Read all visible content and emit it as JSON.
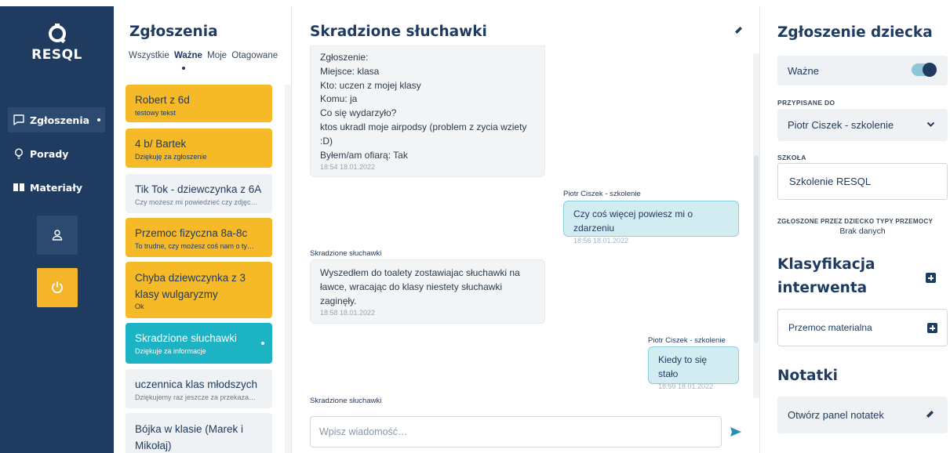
{
  "app": {
    "logo_text": "RESQL"
  },
  "nav": {
    "items": [
      {
        "label": "Zgłoszenia",
        "icon": "message-square-icon",
        "active": true
      },
      {
        "label": "Porady",
        "icon": "lightbulb-icon",
        "active": false
      },
      {
        "label": "Materiały",
        "icon": "book-icon",
        "active": false
      }
    ],
    "user_button": "user-icon",
    "power_button": "power-icon"
  },
  "reports": {
    "title": "Zgłoszenia",
    "filters": [
      "Wszystkie",
      "Ważne",
      "Moje",
      "Otagowane"
    ],
    "active_filter": "Ważne",
    "cards": [
      {
        "title": "Robert z 6d",
        "subtitle": "testowy tekst",
        "color": "yellow"
      },
      {
        "title": "4 b/ Bartek",
        "subtitle": "Dziękuję za zgłoszenie",
        "color": "yellow"
      },
      {
        "title": "Tik Tok - dziewczynka z 6A",
        "subtitle": "Czy możesz mi powiedzieć czy zdjęc…",
        "color": "grey"
      },
      {
        "title": "Przemoc fizyczna 8a-8c",
        "subtitle": "To trudne, czy możesz coś nam o ty…",
        "color": "yellow"
      },
      {
        "title": "Chyba dziewczynka z 3 klasy wulgaryzmy",
        "subtitle": "Ok",
        "color": "yellow"
      },
      {
        "title": "Skradzione słuchawki",
        "subtitle": "Dziękuje za informacje",
        "color": "teal"
      },
      {
        "title": "uczennica klas młodszych",
        "subtitle": "Dziękujemy raz jeszcze za przekaza…",
        "color": "grey"
      },
      {
        "title": "Bójka w klasie (Marek i Mikołaj)",
        "subtitle": "",
        "color": "grey"
      }
    ]
  },
  "chat": {
    "title": "Skradzione słuchawki",
    "messages": [
      {
        "direction": "in",
        "sender": "",
        "lines": [
          "Zgłoszenie:",
          "Miejsce: klasa",
          "Kto: uczen z mojej klasy",
          "Komu: ja",
          "Co się wydarzyło?",
          "ktos ukradl moje airpodsy (problem z zycia wziety",
          ":D)",
          "Byłem/am ofiarą: Tak"
        ],
        "time": "18:54 18.01.2022"
      },
      {
        "direction": "out",
        "sender": "Piotr Ciszek - szkolenie",
        "lines": [
          "Czy coś więcej powiesz mi o zdarzeniu"
        ],
        "time": "18:56 18.01.2022"
      },
      {
        "direction": "in",
        "sender": "Skradzione słuchawki",
        "lines": [
          "Wyszedłem do toalety zostawiajac słuchawki na",
          "ławce, wracając do klasy niestety słuchawki",
          "zaginęły."
        ],
        "time": "18:58 18.01.2022"
      },
      {
        "direction": "out",
        "sender": "Piotr Ciszek - szkolenie",
        "lines": [
          "Kiedy to się stało"
        ],
        "time": "18:59 18.01.2022"
      }
    ],
    "typing_sender": "Skradzione słuchawki",
    "input_placeholder": "Wpisz wiadomość…"
  },
  "panel": {
    "title": "Zgłoszenie dziecka",
    "important_label": "Ważne",
    "important_on": true,
    "assigned_label": "PRZYPISANE DO",
    "assigned_value": "Piotr Ciszek - szkolenie",
    "school_label": "SZKOŁA",
    "school_value": "Szkolenie RESQL",
    "violence_types_label": "ZGŁOSZONE PRZEZ DZIECKO TYPY PRZEMOCY",
    "violence_types_value": "Brak danych",
    "classification_title_1": "Klasyfikacja",
    "classification_title_2": "interwenta",
    "classification_item": "Przemoc materialna",
    "notes_title": "Notatki",
    "notes_button": "Otwórz panel notatek"
  }
}
